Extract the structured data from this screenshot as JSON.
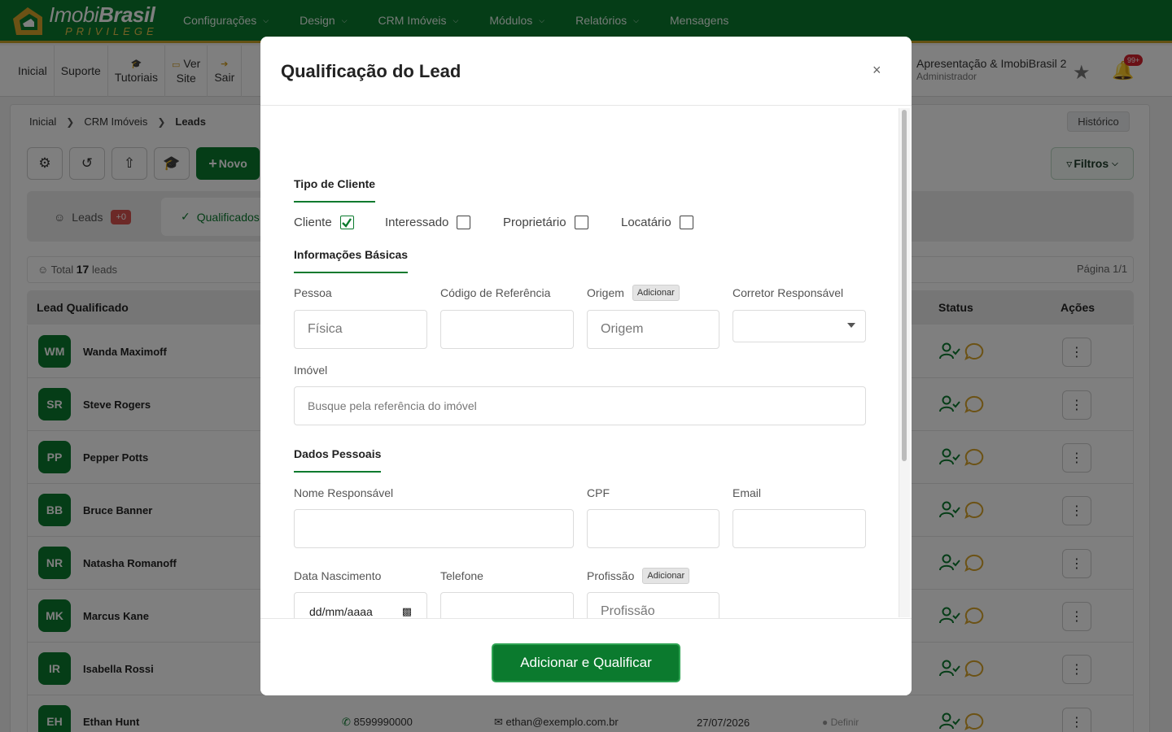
{
  "app": {
    "brand_main": "Imobi",
    "brand_bold": "Brasil",
    "brand_sub": "PRIVILEGE"
  },
  "topnav": [
    {
      "label": "Configurações",
      "dropdown": true
    },
    {
      "label": "Design",
      "dropdown": true
    },
    {
      "label": "CRM Imóveis",
      "dropdown": true
    },
    {
      "label": "Módulos",
      "dropdown": true
    },
    {
      "label": "Relatórios",
      "dropdown": true
    },
    {
      "label": "Mensagens",
      "dropdown": false
    }
  ],
  "subbar": {
    "inicial": "Inicial",
    "suporte": "Suporte",
    "tutoriais": "Tutoriais",
    "ver_site_1": "Ver",
    "ver_site_2": "Site",
    "sair": "Sair",
    "user_name": "Apresentação & ImobiBrasil 2",
    "user_role": "Administrador",
    "notif_count": "99+"
  },
  "breadcrumb": [
    "Inicial",
    "CRM Imóveis",
    "Leads"
  ],
  "historico": "Histórico",
  "toolbar": {
    "new_label": "Novo",
    "filters_label": "Filtros"
  },
  "tabs": {
    "leads_label": "Leads",
    "leads_badge": "+0",
    "qualified_label": "Qualificados"
  },
  "totals": {
    "prefix": "Total",
    "count": "17",
    "suffix": "leads",
    "page": "Página 1/1"
  },
  "table": {
    "col_lead": "Lead Qualificado",
    "col_status": "Status",
    "col_actions": "Ações",
    "rows": [
      {
        "initials": "WM",
        "name": "Wanda Maximoff"
      },
      {
        "initials": "SR",
        "name": "Steve Rogers"
      },
      {
        "initials": "PP",
        "name": "Pepper Potts"
      },
      {
        "initials": "BB",
        "name": "Bruce Banner"
      },
      {
        "initials": "NR",
        "name": "Natasha Romanoff"
      },
      {
        "initials": "MK",
        "name": "Marcus Kane"
      },
      {
        "initials": "IR",
        "name": "Isabella Rossi"
      },
      {
        "initials": "EH",
        "name": "Ethan Hunt",
        "phone": "8599990000",
        "email": "ethan@exemplo.com.br",
        "date": "27/07/2026",
        "status": "Definir"
      }
    ]
  },
  "modal": {
    "title": "Qualificação do Lead",
    "close": "×",
    "section_tipo": "Tipo de Cliente",
    "tipos": [
      {
        "label": "Cliente",
        "checked": true
      },
      {
        "label": "Interessado",
        "checked": false
      },
      {
        "label": "Proprietário",
        "checked": false
      },
      {
        "label": "Locatário",
        "checked": false
      }
    ],
    "section_info": "Informações Básicas",
    "pessoa_label": "Pessoa",
    "pessoa_placeholder": "Física",
    "codigo_label": "Código de Referência",
    "origem_label": "Origem",
    "origem_add": "Adicionar",
    "origem_placeholder": "Origem",
    "corretor_label": "Corretor Responsável",
    "imovel_label": "Imóvel",
    "imovel_placeholder": "Busque pela referência do imóvel",
    "section_dados": "Dados Pessoais",
    "nome_label": "Nome Responsável",
    "cpf_label": "CPF",
    "email_label": "Email",
    "nasc_label": "Data Nascimento",
    "nasc_placeholder": "dd/mm/aaaa",
    "telefone_label": "Telefone",
    "profissao_label": "Profissão",
    "profissao_add": "Adicionar",
    "profissao_placeholder": "Profissão",
    "submit": "Adicionar e Qualificar"
  },
  "colors": {
    "brand_green": "#0b7a2e",
    "brand_gold": "#c9a227",
    "badge_red": "#d4202c"
  }
}
